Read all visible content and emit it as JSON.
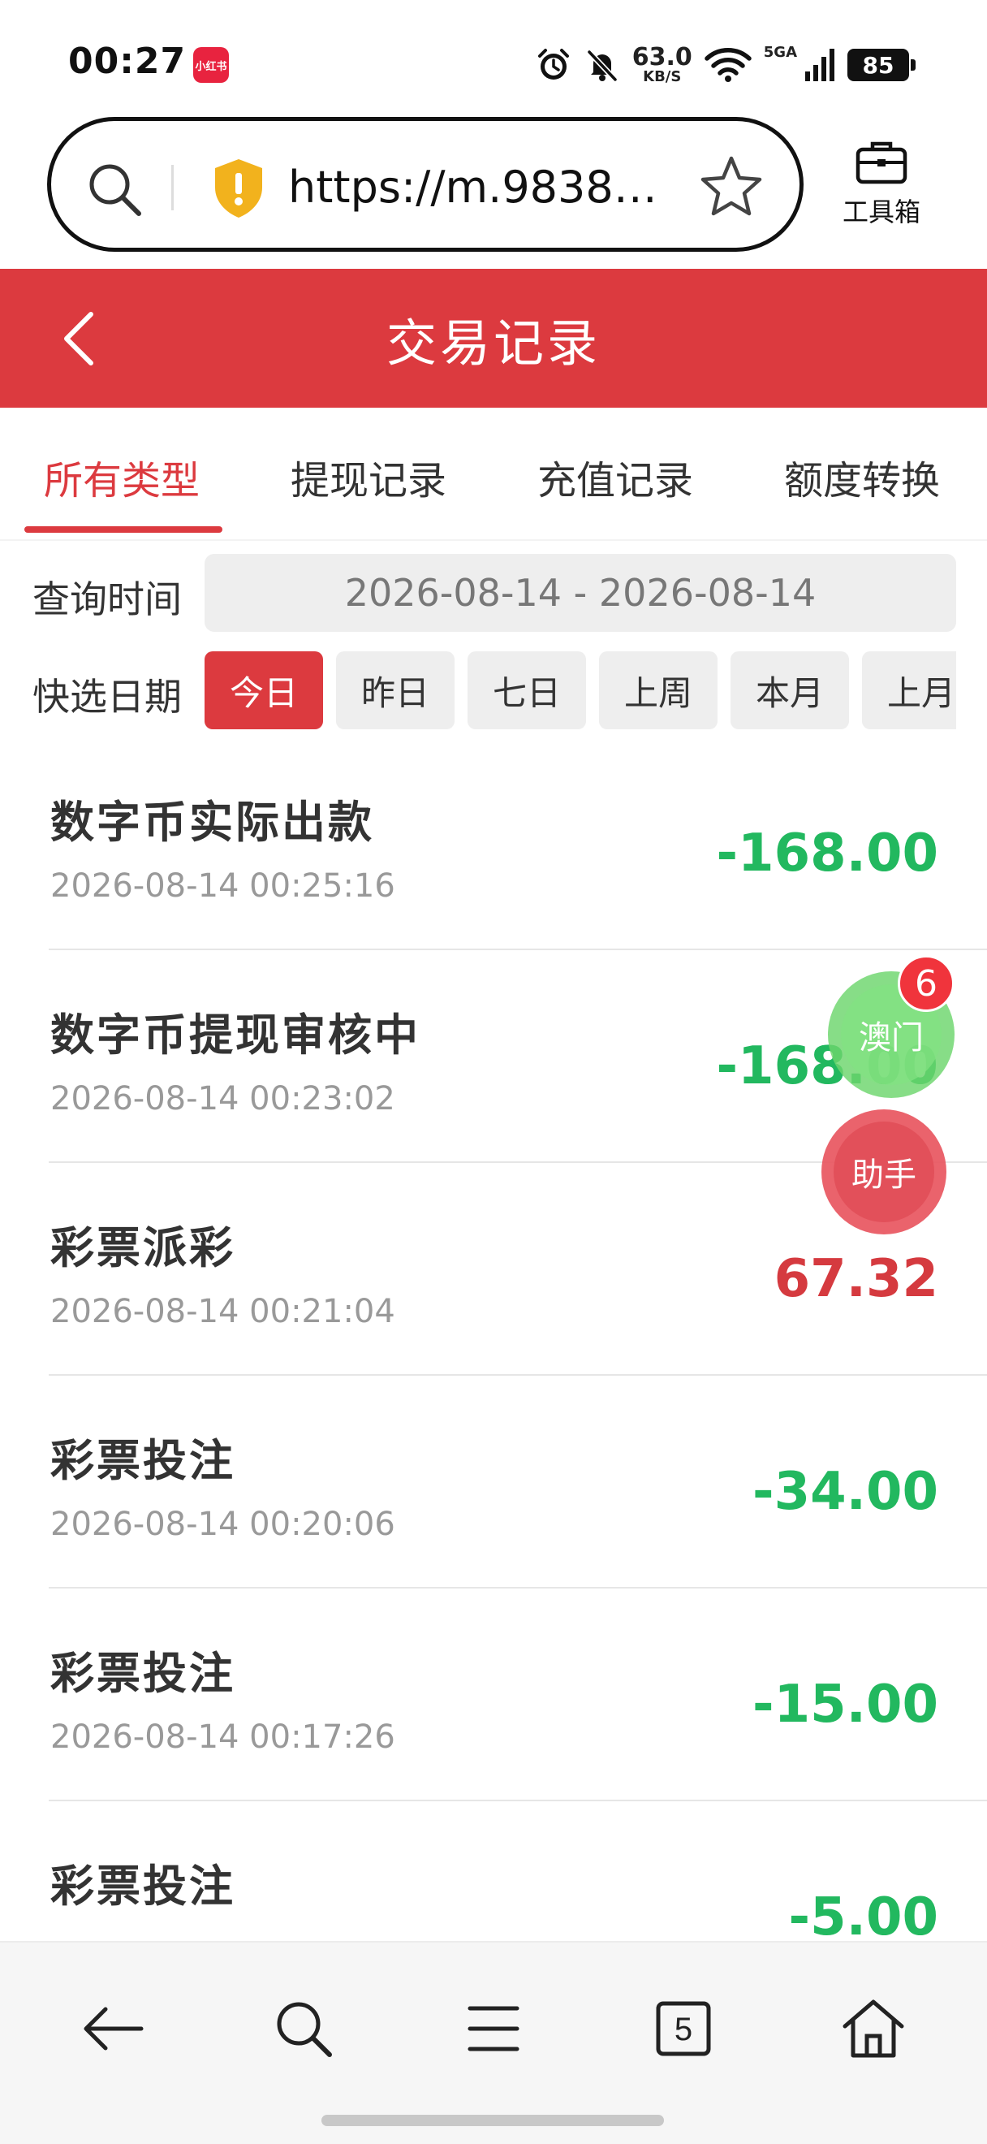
{
  "status_bar": {
    "time": "00:27",
    "app_badge": "小红书",
    "net_speed_value": "63.0",
    "net_speed_unit": "KB/S",
    "signal_label": "5GA",
    "battery": "85"
  },
  "browser": {
    "url": "https://m.98388...",
    "toolbox_label": "工具箱"
  },
  "header": {
    "title": "交易记录"
  },
  "tabs": [
    {
      "label": "所有类型",
      "active": true
    },
    {
      "label": "提现记录",
      "active": false
    },
    {
      "label": "充值记录",
      "active": false
    },
    {
      "label": "额度转换",
      "active": false
    }
  ],
  "filters": {
    "query_label": "查询时间",
    "date_range": "2026-08-14 - 2026-08-14",
    "quick_label": "快选日期",
    "quick_options": [
      {
        "label": "今日",
        "active": true
      },
      {
        "label": "昨日",
        "active": false
      },
      {
        "label": "七日",
        "active": false
      },
      {
        "label": "上周",
        "active": false
      },
      {
        "label": "本月",
        "active": false
      },
      {
        "label": "上月",
        "active": false
      }
    ]
  },
  "records": [
    {
      "title": "数字币实际出款",
      "time": "2026-08-14 00:25:16",
      "amount": "-168.00",
      "sign": "negative"
    },
    {
      "title": "数字币提现审核中",
      "time": "2026-08-14 00:23:02",
      "amount": "-168.00",
      "sign": "negative"
    },
    {
      "title": "彩票派彩",
      "time": "2026-08-14 00:21:04",
      "amount": "67.32",
      "sign": "positive"
    },
    {
      "title": "彩票投注",
      "time": "2026-08-14 00:20:06",
      "amount": "-34.00",
      "sign": "negative"
    },
    {
      "title": "彩票投注",
      "time": "2026-08-14 00:17:26",
      "amount": "-15.00",
      "sign": "negative"
    },
    {
      "title": "彩票投注",
      "time": "",
      "amount": "-5.00",
      "sign": "negative"
    }
  ],
  "floating": {
    "macau_label": "澳门",
    "macau_badge": "6",
    "helper_label": "助手"
  },
  "bottom_nav": {
    "tab_count": "5",
    "icons": [
      "back-arrow-icon",
      "search-icon",
      "menu-icon",
      "tabs-icon",
      "home-icon"
    ]
  },
  "colors": {
    "brand_red": "#dc3a3f",
    "amount_negative": "#22b85f",
    "amount_positive": "#d53a3f",
    "chip_bg": "#eeeeee"
  }
}
